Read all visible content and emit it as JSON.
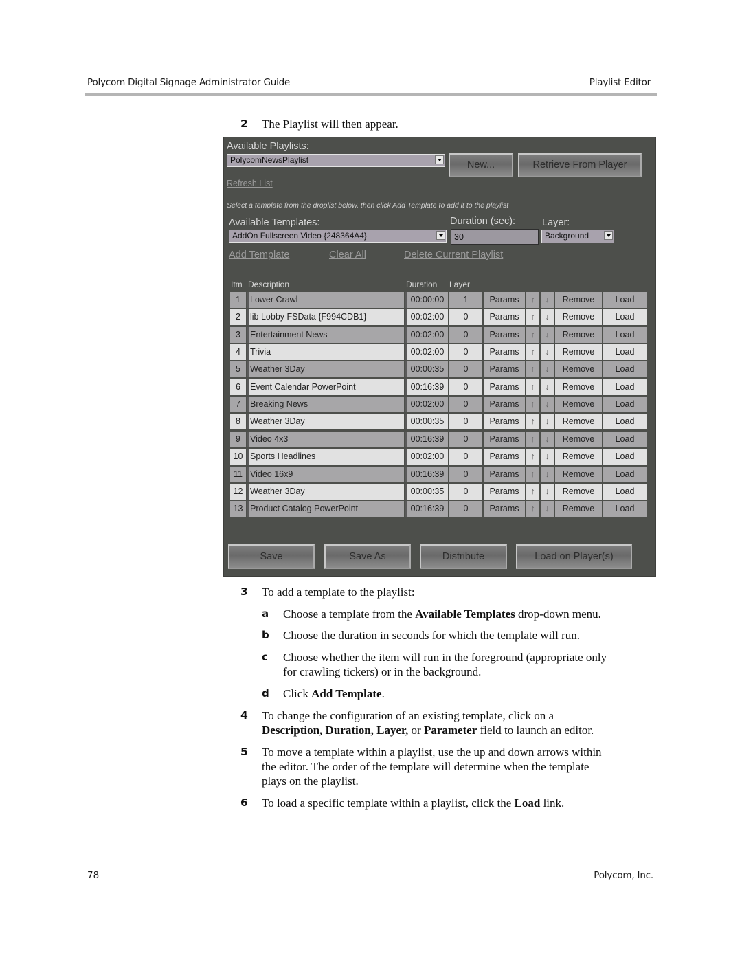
{
  "page_header": {
    "left": "Polycom Digital Signage Administrator Guide",
    "right": "Playlist Editor"
  },
  "intro_step": {
    "number": "2",
    "text": "The Playlist will then appear."
  },
  "app": {
    "available_playlists_label": "Available Playlists:",
    "playlist_select_value": "PolycomNewsPlaylist",
    "new_button": "New...",
    "retrieve_button": "Retrieve From Player",
    "refresh_link": "Refresh List",
    "hint": "Select a template from the droplist below, then click Add Template to add it to the playlist",
    "available_templates_label": "Available Templates:",
    "template_select_value": "AddOn Fullscreen Video {248364A4}",
    "duration_label": "Duration (sec):",
    "duration_value": "30",
    "layer_label": "Layer:",
    "layer_select_value": "Background",
    "add_template_link": "Add Template",
    "clear_all_link": "Clear All",
    "delete_playlist_link": "Delete Current Playlist",
    "table_headers": {
      "item": "Itm",
      "description": "Description",
      "duration": "Duration",
      "layer": "Layer"
    },
    "row_actions": {
      "params": "Params",
      "up": "↑",
      "down": "↓",
      "remove": "Remove",
      "load": "Load"
    },
    "rows": [
      {
        "item": "1",
        "description": "Lower Crawl",
        "duration": "00:00:00",
        "layer": "1"
      },
      {
        "item": "2",
        "description": "lib Lobby FSData {F994CDB1}",
        "duration": "00:02:00",
        "layer": "0"
      },
      {
        "item": "3",
        "description": "Entertainment News",
        "duration": "00:02:00",
        "layer": "0"
      },
      {
        "item": "4",
        "description": "Trivia",
        "duration": "00:02:00",
        "layer": "0"
      },
      {
        "item": "5",
        "description": "Weather 3Day",
        "duration": "00:00:35",
        "layer": "0"
      },
      {
        "item": "6",
        "description": "Event Calendar PowerPoint",
        "duration": "00:16:39",
        "layer": "0"
      },
      {
        "item": "7",
        "description": "Breaking News",
        "duration": "00:02:00",
        "layer": "0"
      },
      {
        "item": "8",
        "description": "Weather 3Day",
        "duration": "00:00:35",
        "layer": "0"
      },
      {
        "item": "9",
        "description": "Video 4x3",
        "duration": "00:16:39",
        "layer": "0"
      },
      {
        "item": "10",
        "description": "Sports Headlines",
        "duration": "00:02:00",
        "layer": "0"
      },
      {
        "item": "11",
        "description": "Video 16x9",
        "duration": "00:16:39",
        "layer": "0"
      },
      {
        "item": "12",
        "description": "Weather 3Day",
        "duration": "00:00:35",
        "layer": "0"
      },
      {
        "item": "13",
        "description": "Product Catalog PowerPoint",
        "duration": "00:16:39",
        "layer": "0"
      }
    ],
    "bottom_buttons": {
      "save": "Save",
      "save_as": "Save As",
      "distribute": "Distribute",
      "load_on_players": "Load on Player(s)"
    }
  },
  "steps": {
    "s3": {
      "number": "3",
      "text": "To add a template to the playlist:"
    },
    "s3a": {
      "letter": "a",
      "pre": "Choose a template from the ",
      "bold": "Available Templates",
      "post": " drop-down menu."
    },
    "s3b": {
      "letter": "b",
      "text": "Choose the duration in seconds for which the template will run."
    },
    "s3c": {
      "letter": "c",
      "line1": "Choose whether the item will run in the foreground (appropriate only",
      "line2": "for crawling tickers) or in the background."
    },
    "s3d": {
      "letter": "d",
      "pre": "Click ",
      "bold": "Add Template",
      "post": "."
    },
    "s4": {
      "number": "4",
      "line1": "To change the configuration of an existing template, click on a",
      "bold1": "Description, Duration, Layer,",
      "mid": " or ",
      "bold2": "Parameter",
      "post": " field to launch an editor."
    },
    "s5": {
      "number": "5",
      "line1": "To move a template within a playlist, use the up and down arrows within",
      "line2": "the editor. The order of the template will determine when the template",
      "line3": "plays on the playlist."
    },
    "s6": {
      "number": "6",
      "pre": "To load a specific template within a playlist, click the ",
      "bold": "Load",
      "post": " link."
    }
  },
  "page_footer": {
    "page_number": "78",
    "company": "Polycom, Inc."
  }
}
